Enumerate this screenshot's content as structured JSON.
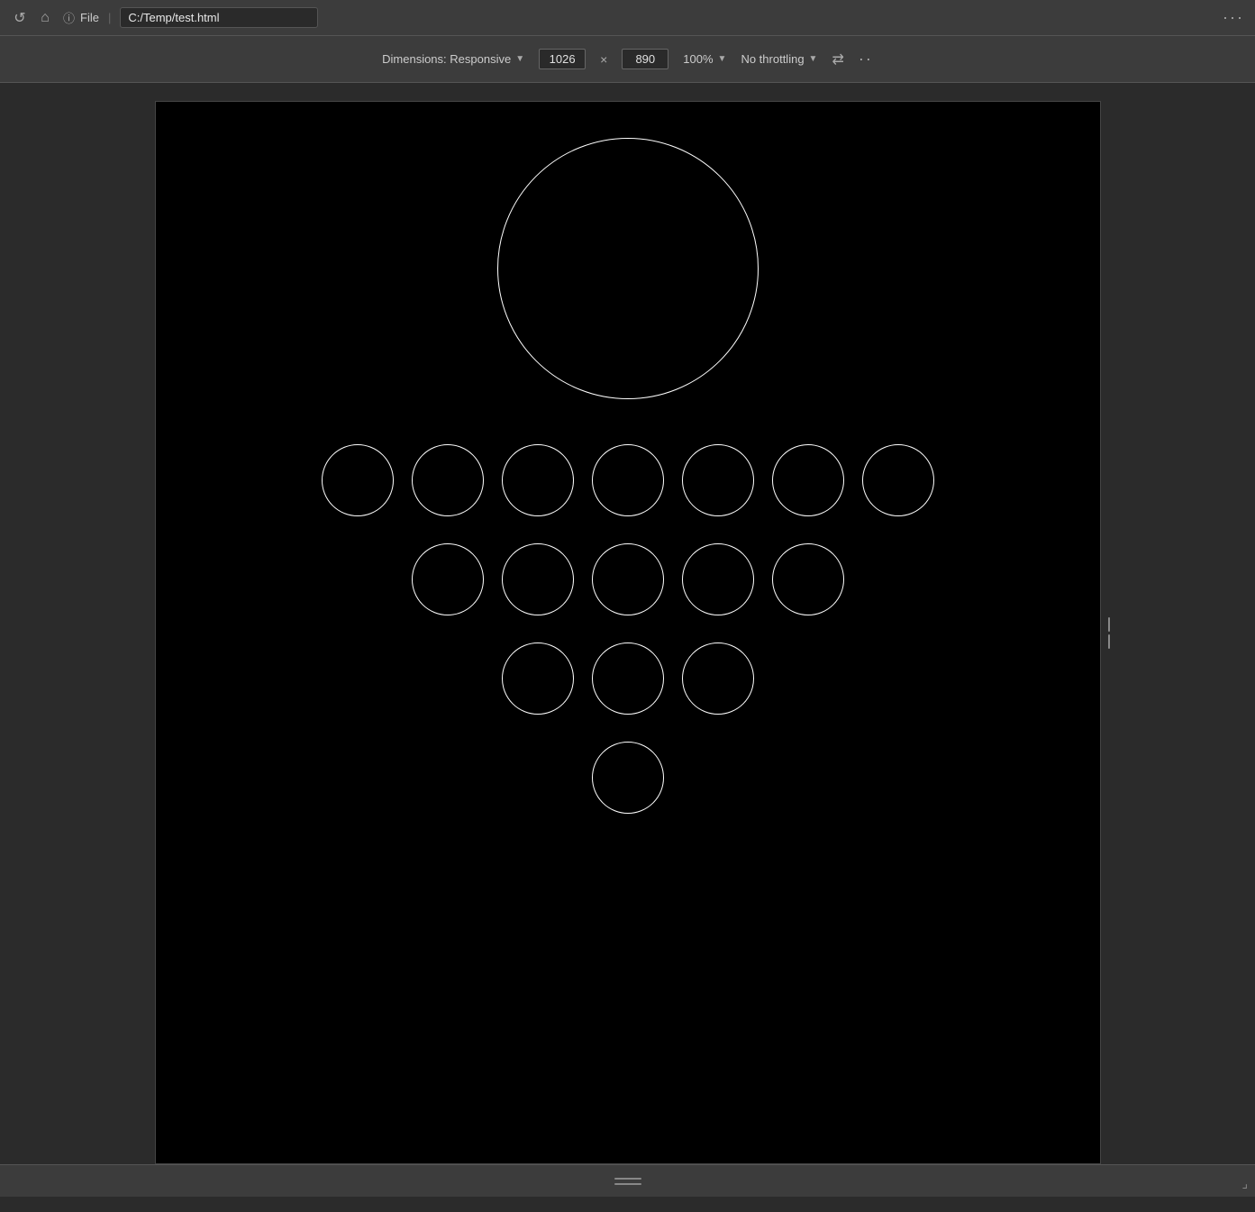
{
  "browser": {
    "file_label": "File",
    "address": "C:/Temp/test.html",
    "more_dots": "···"
  },
  "toolbar": {
    "dimensions_label": "Dimensions: Responsive",
    "width_value": "1026",
    "height_value": "890",
    "zoom_label": "100%",
    "throttle_label": "No throttling",
    "dropdown_char": "▼"
  },
  "canvas": {
    "background": "#000000",
    "large_circle_size": 290,
    "rows": [
      {
        "count": 7
      },
      {
        "count": 5
      },
      {
        "count": 3
      },
      {
        "count": 1
      }
    ],
    "small_circle_size": 80
  },
  "bottom": {
    "drag_handle_label": "==",
    "resize_corner": "⟋"
  }
}
